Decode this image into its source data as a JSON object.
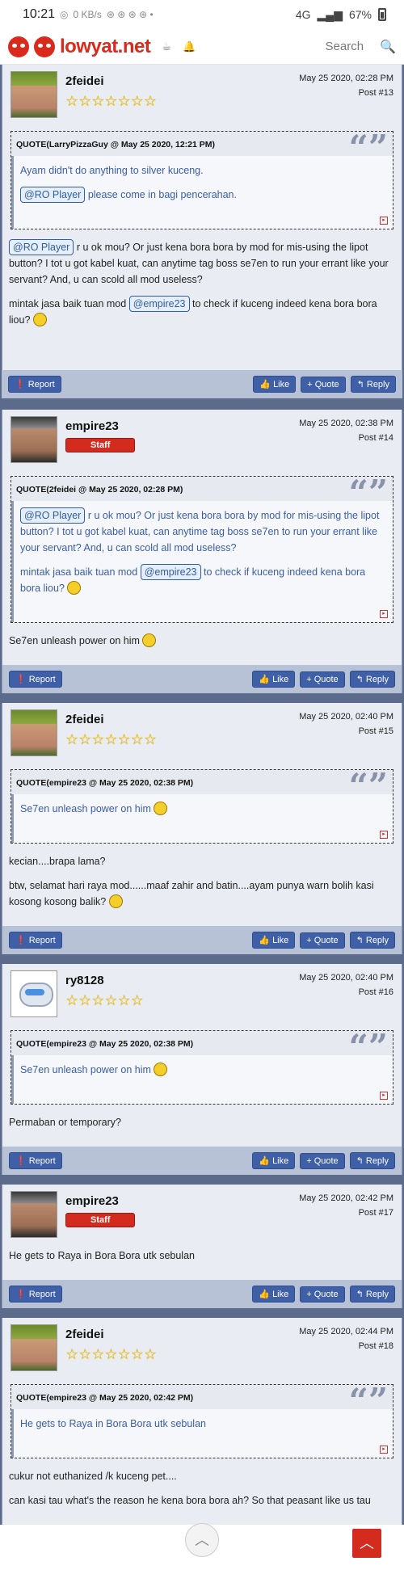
{
  "status": {
    "time": "10:21",
    "net": "0 KB/s",
    "signal": "4G",
    "battery": "67%"
  },
  "header": {
    "brand": "lowyat.net",
    "search_placeholder": "Search"
  },
  "buttons": {
    "report": "Report",
    "like": "Like",
    "quote": "Quote",
    "reply": "Reply"
  },
  "posts": [
    {
      "user": "2feidei",
      "date": "May 25 2020, 02:28 PM",
      "num": "Post #13",
      "quote_head": "QUOTE(LarryPizzaGuy @ May 25 2020, 12:21 PM)",
      "quote_line1": "Ayam didn't do anything to silver kuceng.",
      "quote_tag": "@RO Player",
      "quote_line2": "please come in bagi pencerahan.",
      "tag1": "@RO Player",
      "msg1": "r u ok mou? Or just kena bora bora by mod for mis-using the lipot button? I tot u got kabel kuat, can anytime tag boss se7en to run your errant like your servant? And, u can scold all mod useless?",
      "msg2a": "mintak jasa baik tuan mod",
      "tag2": "@empire23",
      "msg2b": "to check if kuceng indeed kena bora bora liou?"
    },
    {
      "user": "empire23",
      "badge": "Staff",
      "date": "May 25 2020, 02:38 PM",
      "num": "Post #14",
      "quote_head": "QUOTE(2feidei @ May 25 2020, 02:28 PM)",
      "quote_tag": "@RO Player",
      "quote_line1": "r u ok mou? Or just kena bora bora by mod for mis-using the lipot button? I tot u got kabel kuat, can anytime tag boss se7en to run your errant like your servant? And, u can scold all mod useless?",
      "quote_line2a": "mintak jasa baik tuan mod",
      "quote_tag2": "@empire23",
      "quote_line2b": "to check if kuceng indeed kena bora bora liou?",
      "msg1": "Se7en unleash power on him"
    },
    {
      "user": "2feidei",
      "date": "May 25 2020, 02:40 PM",
      "num": "Post #15",
      "quote_head": "QUOTE(empire23 @ May 25 2020, 02:38 PM)",
      "quote_line1": "Se7en unleash power on him",
      "msg1": "kecian....brapa lama?",
      "msg2": "btw, selamat hari raya mod......maaf zahir and batin....ayam punya warn bolih kasi kosong kosong balik?"
    },
    {
      "user": "ry8128",
      "date": "May 25 2020, 02:40 PM",
      "num": "Post #16",
      "quote_head": "QUOTE(empire23 @ May 25 2020, 02:38 PM)",
      "quote_line1": "Se7en unleash power on him",
      "msg1": "Permaban or temporary?"
    },
    {
      "user": "empire23",
      "badge": "Staff",
      "date": "May 25 2020, 02:42 PM",
      "num": "Post #17",
      "msg1": "He gets to Raya in Bora Bora utk sebulan"
    },
    {
      "user": "2feidei",
      "date": "May 25 2020, 02:44 PM",
      "num": "Post #18",
      "quote_head": "QUOTE(empire23 @ May 25 2020, 02:42 PM)",
      "quote_line1": "He gets to Raya in Bora Bora utk sebulan",
      "msg1": "cukur not euthanized /k kuceng pet....",
      "msg2": "can kasi tau what's the reason he kena bora bora ah? So that peasant like us tau"
    }
  ]
}
